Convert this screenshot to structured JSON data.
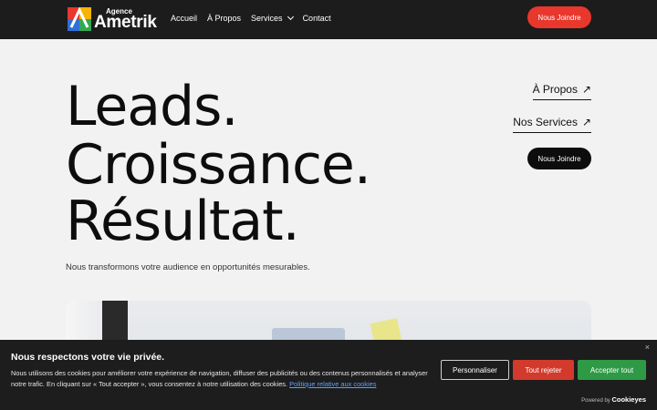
{
  "header": {
    "logo_small": "Agence",
    "logo_name": "Ametrik",
    "nav": [
      {
        "label": "Accueil"
      },
      {
        "label": "À Propos"
      },
      {
        "label": "Services"
      },
      {
        "label": "Contact"
      }
    ],
    "cta_label": "Nous Joindre"
  },
  "hero": {
    "line1": "Leads.",
    "line2": "Croissance.",
    "line3": "Résultat.",
    "subtitle": "Nous transformons votre audience en opportunités mesurables.",
    "link_about": "À Propos",
    "link_services": "Nos Services",
    "arrow": "↗",
    "cta_label": "Nous Joindre"
  },
  "cookie": {
    "title": "Nous respectons votre vie privée.",
    "text": "Nous utilisons des cookies pour améliorer votre expérience de navigation, diffuser des publicités ou des contenus personnalisés et analyser notre trafic. En cliquant sur « Tout accepter », vous consentez à notre utilisation des cookies.",
    "policy_link": "Politique relative aux cookies",
    "customize": "Personnaliser",
    "reject": "Tout rejeter",
    "accept": "Accepter tout",
    "powered_by": "Powered by",
    "powered_brand": "Cookieyes",
    "close": "×"
  },
  "colors": {
    "accent_red": "#e8372c",
    "accept_green": "#2e9a46",
    "reject_red": "#d13a2c",
    "header_bg": "#1c1c1c"
  },
  "icons": [
    "logo-mark-icon",
    "chevron-down-icon",
    "arrow-up-right-icon",
    "close-icon"
  ]
}
